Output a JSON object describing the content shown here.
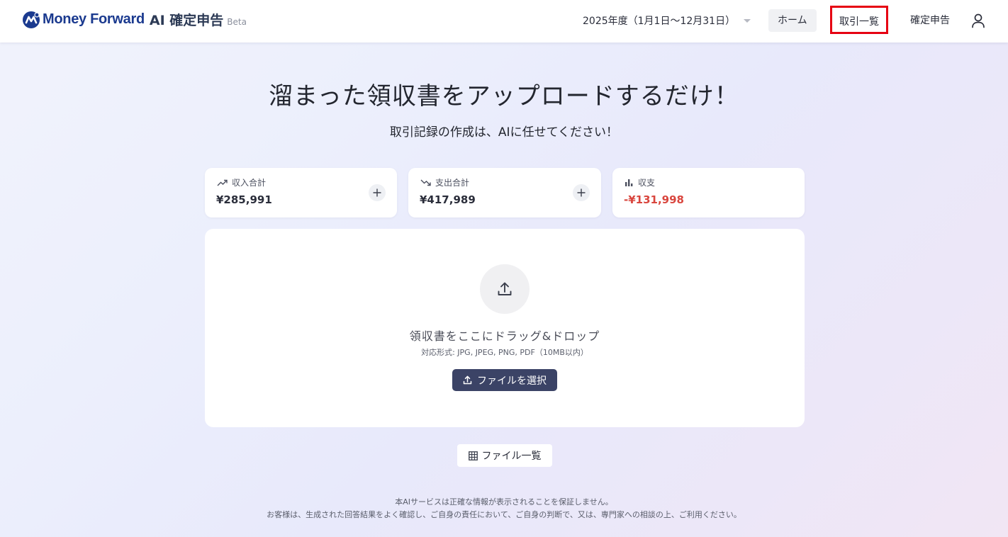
{
  "header": {
    "brand": "Money Forward",
    "product": "AI 確定申告",
    "beta": "Beta",
    "fiscal_year": "2025年度（1月1日〜12月31日）",
    "nav": {
      "home": "ホーム",
      "transactions": "取引一覧",
      "filing": "確定申告"
    },
    "icons": {
      "logo": "moneyforward-logo-icon",
      "caret": "chevron-down-icon",
      "user": "user-icon"
    },
    "highlight_color": "#e60012"
  },
  "hero": {
    "title": "溜まった領収書をアップロードするだけ！",
    "subtitle": "取引記録の作成は、AIに任せてください！"
  },
  "summary": {
    "income": {
      "label": "収入合計",
      "value": "¥285,991",
      "icon": "trending-up-icon"
    },
    "expense": {
      "label": "支出合計",
      "value": "¥417,989",
      "icon": "trending-down-icon"
    },
    "balance": {
      "label": "収支",
      "value": "-¥131,998",
      "icon": "bar-chart-icon",
      "value_color": "#d9463e"
    }
  },
  "upload": {
    "drop_text": "領収書をここにドラッグ&ドロップ",
    "formats": "対応形式: JPG, JPEG, PNG, PDF（10MB以内）",
    "select_button": "ファイルを選択",
    "icon": "upload-icon",
    "button_color": "#3b4366"
  },
  "file_list": {
    "label": "ファイル一覧",
    "icon": "grid-icon"
  },
  "disclaimer": {
    "line1": "本AIサービスは正確な情報が表示されることを保証しません。",
    "line2": "お客様は、生成された回答結果をよく確認し、ご自身の責任において、ご自身の判断で、又は、専門家への相談の上、ご利用ください。"
  }
}
